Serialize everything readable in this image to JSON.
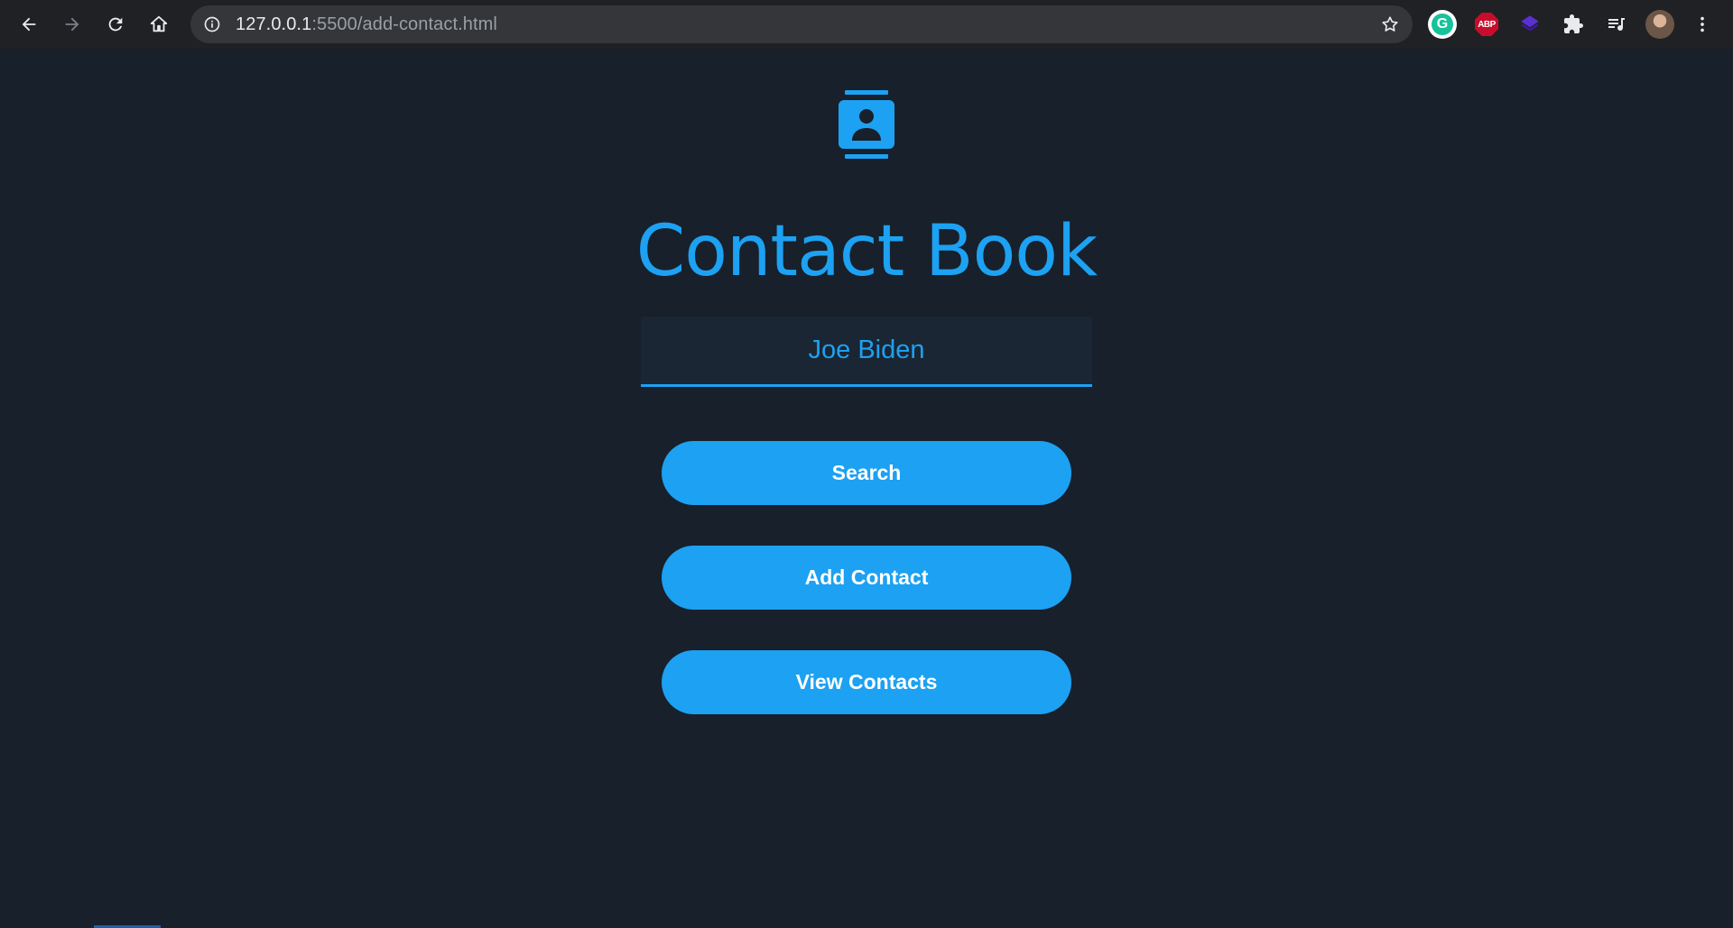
{
  "browser": {
    "url_host": "127.0.0.1",
    "url_rest": ":5500/add-contact.html",
    "extensions": [
      "grammarly-icon",
      "adblock-plus-icon",
      "purple-layers-icon",
      "puzzle-extensions-icon",
      "media-queue-icon"
    ],
    "abp_label": "ABP",
    "grammarly_label": "G"
  },
  "app": {
    "title": "Contact Book",
    "accent_color": "#1da1f2",
    "background_color": "#17202b"
  },
  "search": {
    "value": "Joe Biden",
    "placeholder": ""
  },
  "buttons": {
    "search_label": "Search",
    "add_label": "Add Contact",
    "view_label": "View Contacts"
  }
}
